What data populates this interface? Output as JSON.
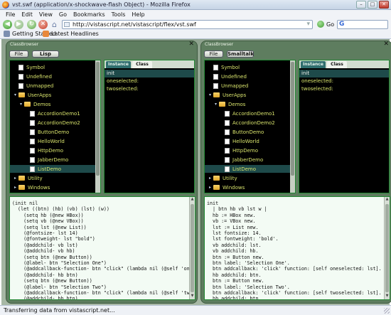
{
  "window": {
    "title": "vst.swf (application/x-shockwave-flash Object) - Mozilla Firefox"
  },
  "menu": [
    "File",
    "Edit",
    "View",
    "Go",
    "Bookmarks",
    "Tools",
    "Help"
  ],
  "nav": {
    "back": "◀",
    "forward": "▶",
    "reload": "↻",
    "stop": "✕",
    "home": "⌂",
    "url": "http://vistascript.net/vistascript/flex/vst.swf",
    "go_label": "Go",
    "search_icon": "G"
  },
  "bookmarks": [
    {
      "label": "Getting Started",
      "icon": "page-icon"
    },
    {
      "label": "Latest Headlines",
      "icon": "rss-icon"
    }
  ],
  "browsers": [
    {
      "title": "ClassBrowser",
      "file_label": "File",
      "lang_label": "Lisp",
      "tree": [
        {
          "label": "Symbol",
          "type": "doc",
          "indent": 1
        },
        {
          "label": "Undefined",
          "type": "doc",
          "indent": 1
        },
        {
          "label": "Unmapped",
          "type": "doc",
          "indent": 1
        },
        {
          "label": "UserApps",
          "type": "folder",
          "indent": 0,
          "open": true
        },
        {
          "label": "Demos",
          "type": "folder",
          "indent": 1,
          "open": true
        },
        {
          "label": "AccordionDemo1",
          "type": "doc",
          "indent": 3
        },
        {
          "label": "AccordionDemo2",
          "type": "doc",
          "indent": 3
        },
        {
          "label": "ButtonDemo",
          "type": "doc",
          "indent": 3
        },
        {
          "label": "HelloWorld",
          "type": "doc",
          "indent": 3
        },
        {
          "label": "HttpDemo",
          "type": "doc",
          "indent": 3
        },
        {
          "label": "JabberDemo",
          "type": "doc",
          "indent": 3
        },
        {
          "label": "ListDemo",
          "type": "doc",
          "indent": 3,
          "selected": true
        },
        {
          "label": "Utility",
          "type": "folder",
          "indent": 0
        },
        {
          "label": "Windows",
          "type": "folder",
          "indent": 0
        }
      ],
      "tabs": {
        "instance": "Instance",
        "class": "Class"
      },
      "instances": [
        {
          "label": "init",
          "selected": true
        },
        {
          "label": "oneselected:"
        },
        {
          "label": "twoselected:"
        }
      ],
      "code": [
        "(init nil",
        "  (let ((btn) (hb) (vb) (lst) (w))",
        "    (setq hb (@new HBox))",
        "    (setq vb (@new VBox))",
        "    (setq lst (@new List))",
        "    (@fontsize- lst 14)",
        "    (@fontweight- lst \"bold\")",
        "    (@addchild- vb lst)",
        "    (@addchild- vb hb)",
        "    (setq btn (@new Button))",
        "    (@label- btn \"Selection One\")",
        "    (@addcallback-function- btn \"click\" (lambda nil (@self 'onesele",
        "    (@addchild- hb btn)",
        "    (setq btn (@new Button))",
        "    (@label- btn \"Selection Two\")",
        "    (@addcallback-function- btn \"click\" (lambda nil (@self 'twosele",
        "    (@addchild- hb btn)"
      ]
    },
    {
      "title": "ClassBrowser",
      "file_label": "File",
      "lang_label": "Smalltalk",
      "tree": [
        {
          "label": "Symbol",
          "type": "doc",
          "indent": 1
        },
        {
          "label": "Undefined",
          "type": "doc",
          "indent": 1
        },
        {
          "label": "Unmapped",
          "type": "doc",
          "indent": 1
        },
        {
          "label": "UserApps",
          "type": "folder",
          "indent": 0,
          "open": true
        },
        {
          "label": "Demos",
          "type": "folder",
          "indent": 1,
          "open": true
        },
        {
          "label": "AccordionDemo1",
          "type": "doc",
          "indent": 3
        },
        {
          "label": "AccordionDemo2",
          "type": "doc",
          "indent": 3
        },
        {
          "label": "ButtonDemo",
          "type": "doc",
          "indent": 3
        },
        {
          "label": "HelloWorld",
          "type": "doc",
          "indent": 3
        },
        {
          "label": "HttpDemo",
          "type": "doc",
          "indent": 3
        },
        {
          "label": "JabberDemo",
          "type": "doc",
          "indent": 3
        },
        {
          "label": "ListDemo",
          "type": "doc",
          "indent": 3,
          "selected": true
        },
        {
          "label": "Utility",
          "type": "folder",
          "indent": 0
        },
        {
          "label": "Windows",
          "type": "folder",
          "indent": 0
        }
      ],
      "tabs": {
        "instance": "Instance",
        "class": "Class"
      },
      "instances": [
        {
          "label": "init",
          "selected": true
        },
        {
          "label": "oneselected:"
        },
        {
          "label": "twoselected:"
        }
      ],
      "code": [
        "init",
        "  | btn hb vb lst w |",
        "  hb := HBox new.",
        "  vb := VBox new.",
        "  lst := List new.",
        "  lst fontsize: 14.",
        "  lst fontweight: 'bold'.",
        "  vb addchild: lst.",
        "  vb addchild: hb.",
        "  btn := Button new.",
        "  btn label: 'Selection One'.",
        "  btn addcallback: 'click' function: [self oneselected: lst].",
        "  hb addchild: btn.",
        "  btn := Button new.",
        "  btn label: 'Selection Two'.",
        "  btn addcallback: 'click' function: [self twoselected: lst].",
        "  hb addchild: btn."
      ]
    }
  ],
  "status": "Transferring data from vistascript.net..."
}
